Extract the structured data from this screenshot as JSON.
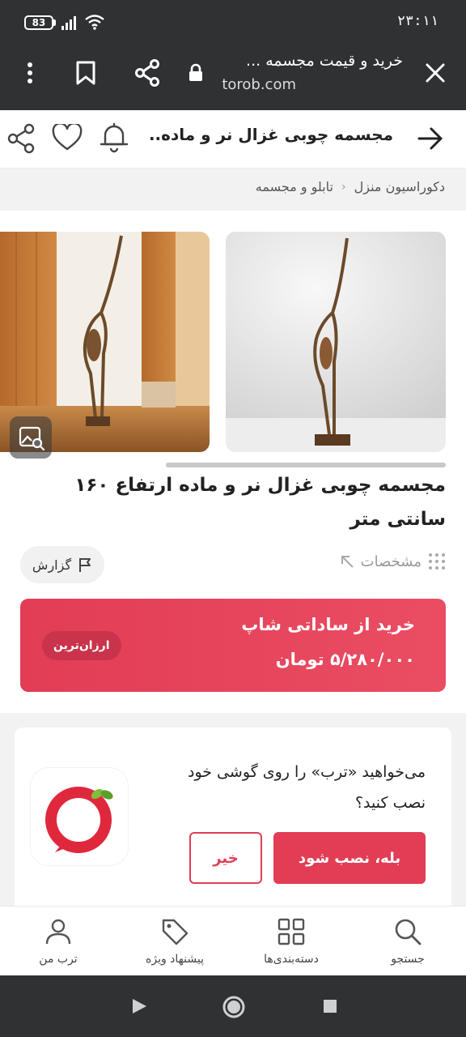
{
  "status_bar": {
    "battery": "83",
    "time": "۲۳:۱۱",
    "icons": [
      "battery-icon",
      "signal-icon",
      "wifi-icon"
    ]
  },
  "browser": {
    "tab_title": "خرید و قیمت مجسمه ...",
    "domain": "torob.com",
    "icons": [
      "close-icon",
      "lock-icon",
      "share-icon",
      "bookmark-icon",
      "more-vert-icon"
    ]
  },
  "header": {
    "title": "مجسمه چوبی غزال نر و ماده...",
    "icons": [
      "back-arrow-icon",
      "bell-icon",
      "heart-icon",
      "share-icon"
    ]
  },
  "breadcrumb": [
    "دکوراسیون منزل",
    "تابلو و مجسمه"
  ],
  "product": {
    "title": "مجسمه چوبی غزال نر و ماده ارتفاع ۱۶۰ سانتی متر",
    "specs_label": "مشخصات",
    "report_label": "گزارش"
  },
  "offer": {
    "store": "خرید از ساداتی شاپ",
    "price": "۵/۲۸۰/۰۰۰ تومان",
    "badge": "ارزان‌ترین",
    "accent": "#e23d55"
  },
  "install": {
    "question": "می‌خواهید «ترب» را روی گوشی خود نصب کنید؟",
    "yes": "بله، نصب شود",
    "no": "خیر"
  },
  "bottom_nav": [
    {
      "label": "جستجو",
      "icon": "search-icon"
    },
    {
      "label": "دسته‌بندی‌ها",
      "icon": "grid-icon"
    },
    {
      "label": "پیشنهاد ویژه",
      "icon": "tag-icon"
    },
    {
      "label": "ترب من",
      "icon": "user-icon"
    }
  ]
}
